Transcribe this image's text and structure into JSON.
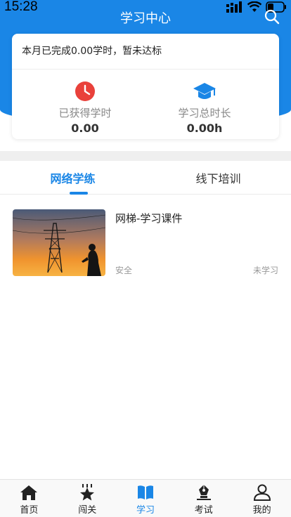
{
  "status_bar": {
    "time": "15:28"
  },
  "header": {
    "title": "学习中心"
  },
  "summary": {
    "message": "本月已完成0.00学时，暂未达标",
    "stats": [
      {
        "icon": "clock-icon",
        "label": "已获得学时",
        "value": "0.00"
      },
      {
        "icon": "graduation-cap-icon",
        "label": "学习总时长",
        "value": "0.00h"
      }
    ]
  },
  "tabs": [
    {
      "label": "网络学练",
      "active": true
    },
    {
      "label": "线下培训",
      "active": false
    }
  ],
  "courses": [
    {
      "title": "网梯-学习课件",
      "category": "安全",
      "status": "未学习",
      "thumbnail_icon": "power-tower-sunset-image"
    }
  ],
  "bottom_nav": [
    {
      "label": "首页",
      "icon": "home-icon",
      "active": false
    },
    {
      "label": "闯关",
      "icon": "star-badge-icon",
      "active": false
    },
    {
      "label": "学习",
      "icon": "book-icon",
      "active": true
    },
    {
      "label": "考试",
      "icon": "pen-icon",
      "active": false
    },
    {
      "label": "我的",
      "icon": "user-icon",
      "active": false
    }
  ],
  "colors": {
    "accent": "#1a86e6",
    "clock": "#e9413b",
    "muted": "#999999"
  }
}
